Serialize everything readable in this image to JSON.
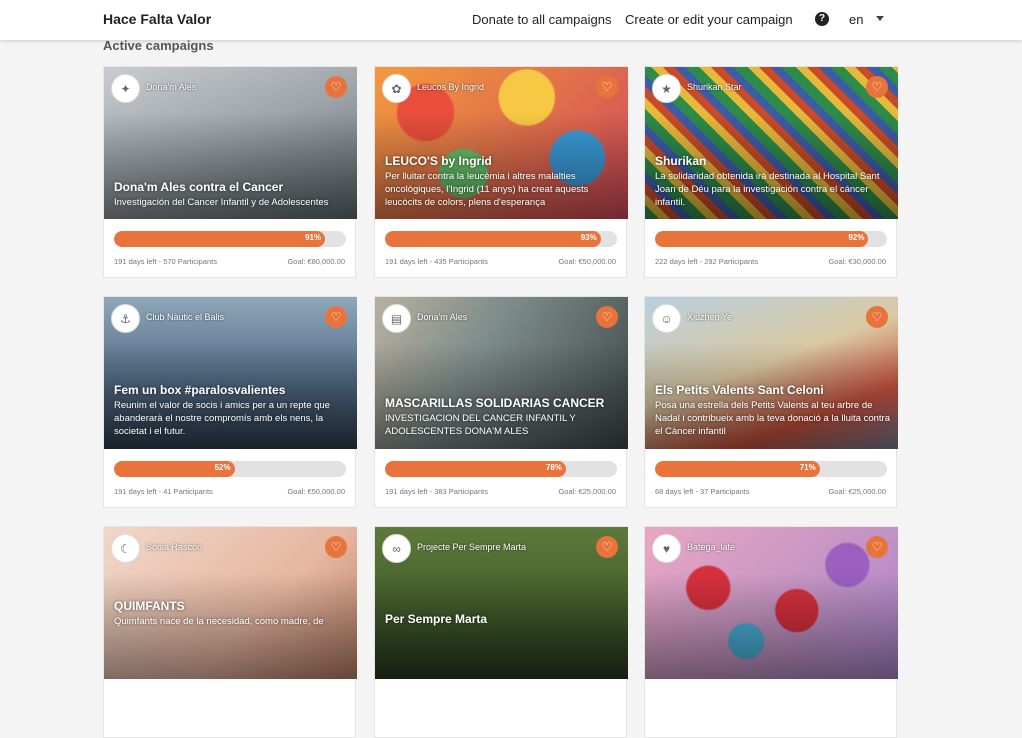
{
  "header": {
    "brand": "Hace Falta Valor",
    "donate_all": "Donate to all campaigns",
    "create_edit": "Create or edit your campaign",
    "help_glyph": "?",
    "language": "en"
  },
  "section_title": "Active campaigns",
  "accent_color": "#e8743b",
  "campaigns": [
    {
      "org": "Dona'm Ales",
      "title": "Dona'm Ales contra el Cancer",
      "description": "Investigación del Cancer Infantil y de Adolescentes",
      "progress_label": "91%",
      "days_participants": "191 days left - 570 Participants",
      "goal": "Goal: €80,000.00"
    },
    {
      "org": "Leucos By Ingrid",
      "title": "LEUCO'S by Ingrid",
      "description": "Per lluitar contra la leucèmia i altres malalties oncològiques, l'Ingrid (11 anys) ha creat aquests leucòcits de colors, plens d'esperança",
      "progress_label": "93%",
      "days_participants": "191 days left - 435 Participants",
      "goal": "Goal: €50,000.00"
    },
    {
      "org": "Shurikan Star",
      "title": "Shurikan",
      "description": "La solidaridad obtenida irá destinada al Hospital Sant Joan de Déu para la investigación contra el cáncer infantil.",
      "progress_label": "92%",
      "days_participants": "222 days left - 292 Participants",
      "goal": "Goal: €30,000.00"
    },
    {
      "org": "Club Nàutic el Balis",
      "title": "Fem un box #paralosvalientes",
      "description": "Reunim el valor de socis i amics per a un repte que abanderarà el nostre compromís amb els nens, la societat i el futur.",
      "progress_label": "52%",
      "days_participants": "191 days left - 41 Participants",
      "goal": "Goal: €50,000.00"
    },
    {
      "org": "Dona'm Ales",
      "title": "MASCARILLAS SOLIDARIAS CANCER",
      "description": "INVESTIGACION DEL CANCER INFANTIL Y ADOLESCENTES DONA'M ALES",
      "progress_label": "78%",
      "days_participants": "191 days left - 383 Participants",
      "goal": "Goal: €25,000.00"
    },
    {
      "org": "Xiuzhen Ye",
      "title": "Els Petits Valents Sant Celoni",
      "description": "Posa una estrella dels Petits Valents al teu arbre de Nadal i contribueix amb la teva donació a la lluita contra el Càncer infantil",
      "progress_label": "71%",
      "days_participants": "68 days left - 37 Participants",
      "goal": "Goal: €25,000.00"
    },
    {
      "org": "Sonia Rascón",
      "title": "QUIMFANTS",
      "description": "Quimfants nace de la necesidad, como madre, de"
    },
    {
      "org": "Projecte Per Sempre Marta",
      "title": "Per Sempre Marta",
      "description": ""
    },
    {
      "org": "Batega_late",
      "title": "",
      "description": ""
    }
  ],
  "progress_values": [
    0.91,
    0.93,
    0.92,
    0.52,
    0.78,
    0.71
  ]
}
